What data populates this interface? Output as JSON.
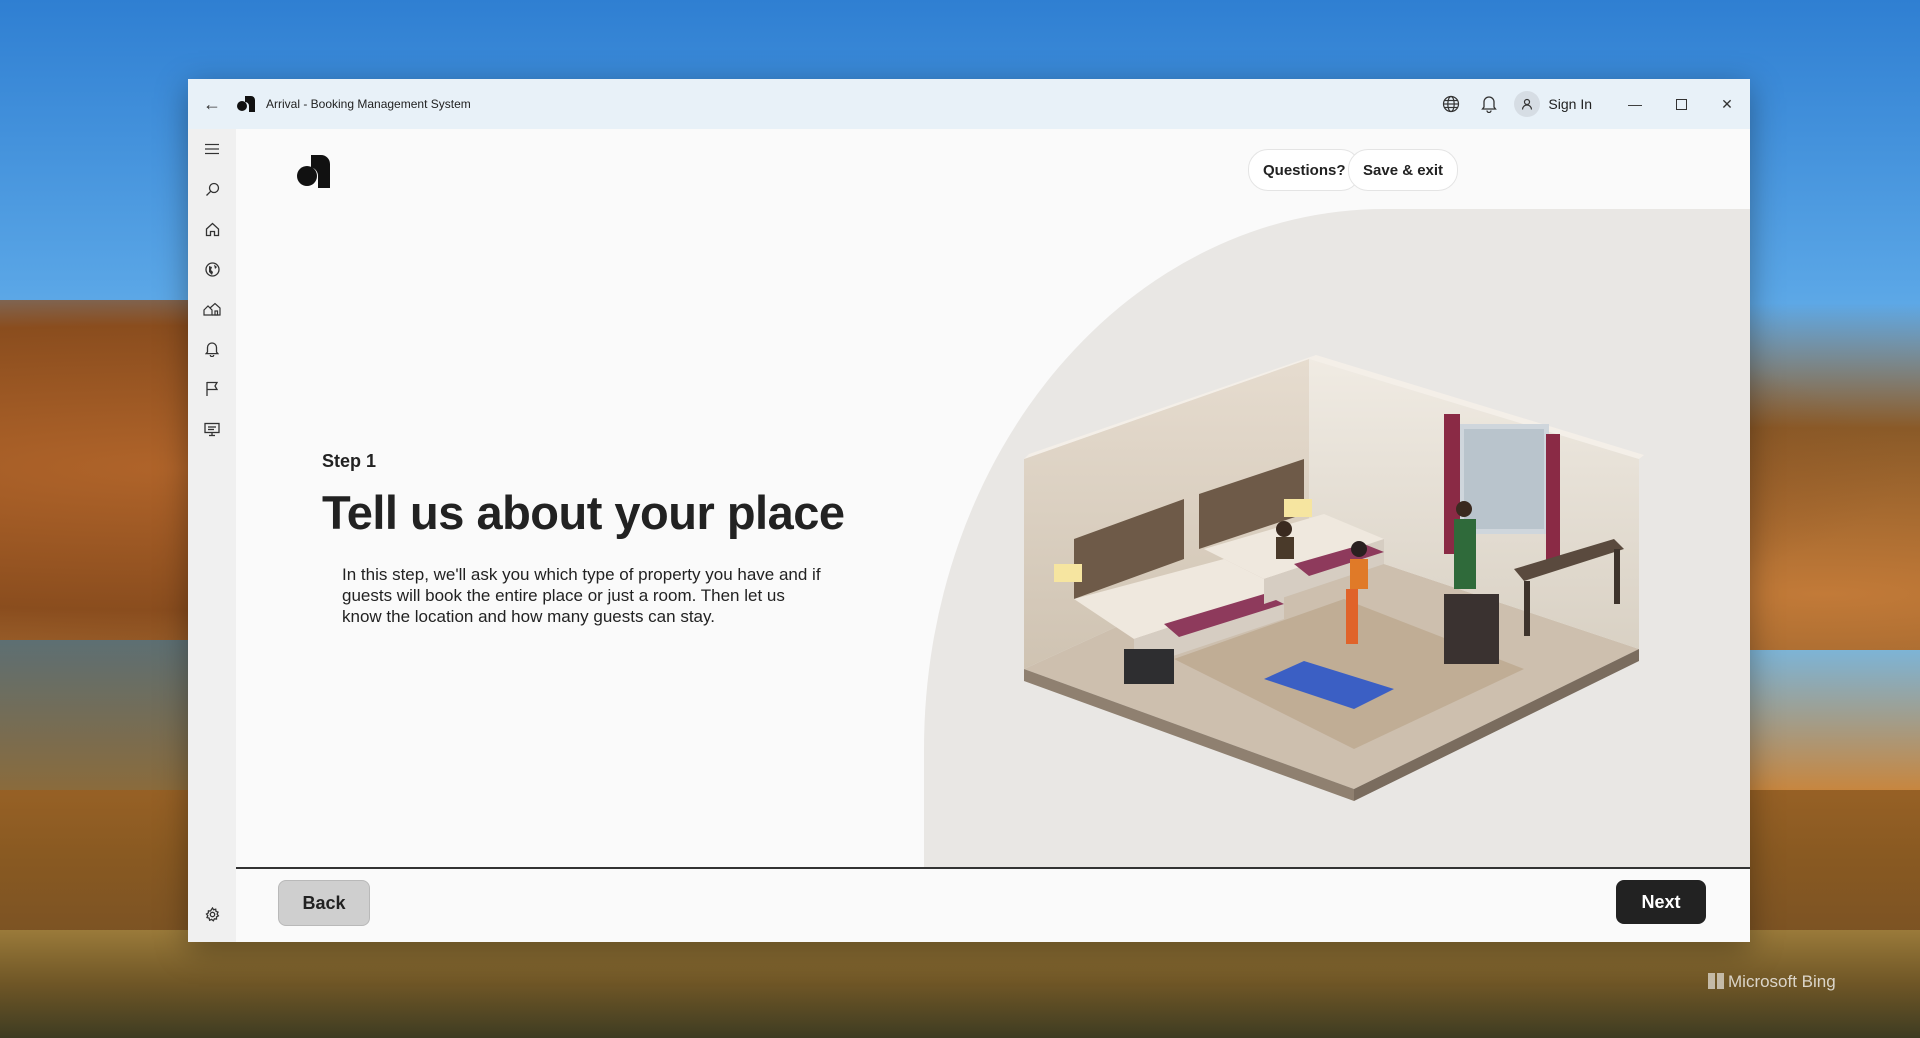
{
  "window": {
    "title": "Arrival - Booking Management System",
    "sign_in_label": "Sign In"
  },
  "sidebar": {
    "items": [
      {
        "icon": "menu-icon"
      },
      {
        "icon": "search-icon"
      },
      {
        "icon": "home-icon"
      },
      {
        "icon": "globe-icon"
      },
      {
        "icon": "houses-icon"
      },
      {
        "icon": "bell-icon"
      },
      {
        "icon": "flag-icon"
      },
      {
        "icon": "monitor-icon"
      }
    ],
    "settings_icon": "gear-icon"
  },
  "header": {
    "questions_label": "Questions?",
    "save_exit_label": "Save & exit"
  },
  "main": {
    "step_label": "Step 1",
    "title": "Tell us about your place",
    "description": "In this step, we'll ask you which type of property you have and if guests will book the entire place or just a room. Then let us know the location and how many guests can stay."
  },
  "footer": {
    "back_label": "Back",
    "next_label": "Next"
  },
  "desktop": {
    "watermark": "Microsoft Bing"
  },
  "colors": {
    "titlebar": "#e8f1f8",
    "next_button": "#222222",
    "back_button": "#cfcfcf",
    "hero_bg": "#e9e7e4"
  }
}
